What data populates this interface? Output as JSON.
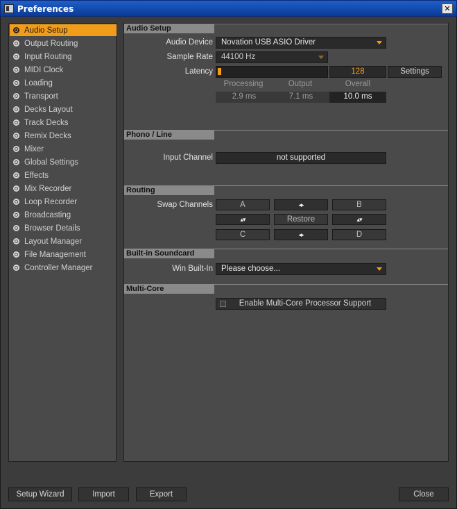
{
  "window": {
    "title": "Preferences",
    "close_glyph": "✕"
  },
  "sidebar": {
    "items": [
      {
        "label": "Audio Setup",
        "active": true
      },
      {
        "label": "Output Routing"
      },
      {
        "label": "Input Routing"
      },
      {
        "label": "MIDI Clock"
      },
      {
        "label": "Loading"
      },
      {
        "label": "Transport"
      },
      {
        "label": "Decks Layout"
      },
      {
        "label": "Track Decks"
      },
      {
        "label": "Remix Decks"
      },
      {
        "label": "Mixer"
      },
      {
        "label": "Global Settings"
      },
      {
        "label": "Effects"
      },
      {
        "label": "Mix Recorder"
      },
      {
        "label": "Loop Recorder"
      },
      {
        "label": "Broadcasting"
      },
      {
        "label": "Browser Details"
      },
      {
        "label": "Layout Manager"
      },
      {
        "label": "File Management"
      },
      {
        "label": "Controller Manager"
      }
    ]
  },
  "audio_setup": {
    "heading": "Audio Setup",
    "audio_device_label": "Audio Device",
    "audio_device_value": "Novation USB ASIO Driver",
    "sample_rate_label": "Sample Rate",
    "sample_rate_value": "44100 Hz",
    "latency_label": "Latency",
    "latency_value": "128",
    "settings_button": "Settings",
    "metrics": {
      "processing_label": "Processing",
      "output_label": "Output",
      "overall_label": "Overall",
      "processing_value": "2.9 ms",
      "output_value": "7.1 ms",
      "overall_value": "10.0 ms"
    }
  },
  "phono_line": {
    "heading": "Phono / Line",
    "input_channel_label": "Input Channel",
    "input_channel_value": "not supported"
  },
  "routing": {
    "heading": "Routing",
    "swap_channels_label": "Swap Channels",
    "channel_a": "A",
    "channel_b": "B",
    "channel_c": "C",
    "channel_d": "D",
    "restore_button": "Restore",
    "swap_lr_glyph": "◂▸",
    "swap_ud_glyph": "▴▾"
  },
  "builtin_soundcard": {
    "heading": "Built-in Soundcard",
    "win_builtin_label": "Win Built-In",
    "win_builtin_value": "Please choose..."
  },
  "multicore": {
    "heading": "Multi-Core",
    "checkbox_label": "Enable Multi-Core Processor Support",
    "checked": false
  },
  "footer": {
    "setup_wizard": "Setup Wizard",
    "import": "Import",
    "export": "Export",
    "close": "Close"
  },
  "colors": {
    "accent": "#f29d1a",
    "panel": "#4a4a4a",
    "section_header": "#8a8a8a"
  }
}
